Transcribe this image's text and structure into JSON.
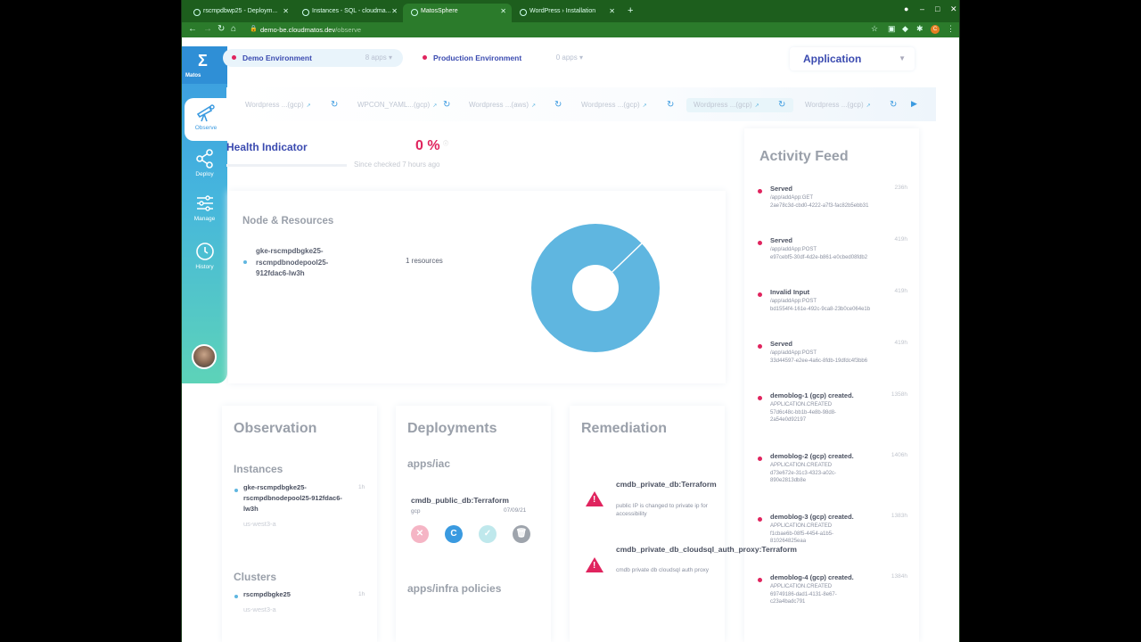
{
  "browser": {
    "tabs": [
      {
        "title": "rscmpdbwp25 - Deploym..."
      },
      {
        "title": "Instances - SQL - cloudma..."
      },
      {
        "title": "MatosSphere"
      },
      {
        "title": "WordPress › Installation"
      }
    ],
    "url_domain": "demo-be.cloudmatos.dev",
    "url_path": "/observe",
    "avatar_letter": "C"
  },
  "app": {
    "logo_text": "Matos",
    "nav": [
      {
        "label": "Observe"
      },
      {
        "label": "Deploy"
      },
      {
        "label": "Manage"
      },
      {
        "label": "History"
      }
    ],
    "environments": [
      {
        "name": "Demo Environment",
        "count": "8 apps"
      },
      {
        "name": "Production Environment",
        "count": "0 apps"
      }
    ],
    "app_select": "Application",
    "app_chips": [
      "Wordpress ...(gcp)",
      "WPCON_YAML...(gcp)",
      "Wordpress ...(aws)",
      "Wordpress ...(gcp)",
      "Wordpress ...(gcp)",
      "Wordpress ...(gcp)"
    ],
    "health": {
      "title": "Health Indicator",
      "percent": "0 %",
      "since": "Since checked 7 hours ago"
    },
    "node": {
      "title": "Node & Resources",
      "name": "gke-rscmpdbgke25-rscmpdbnodepool25-912fdac6-lw3h",
      "resources": "1 resources"
    },
    "activity": {
      "title": "Activity Feed",
      "items": [
        {
          "title": "Served",
          "time": "236h",
          "desc": "/app/addApp:GET\n2ae78c3d-cbd0-4222-a7f3-fac82b5ebb31"
        },
        {
          "title": "Served",
          "time": "419h",
          "desc": "/app/addApp:POST\ne97cebf5-30df-4d2e-b861-e0cbed08fdb2"
        },
        {
          "title": "Invalid Input",
          "time": "419h",
          "desc": "/app/addApp:POST\nbd1554f4-161e-492c-9ca8-23b0ce064e1b"
        },
        {
          "title": "Served",
          "time": "419h",
          "desc": "/app/addApp:POST\n33d44597-e2ee-4a6c-8fdb-19dfdc4f3bb6"
        },
        {
          "title": "demoblog-1 (gcp) created.",
          "time": "1358h",
          "desc": "APPLICATION.CREATED\n57d6c48c-bb1b-4e8b-98d8-\n2a54e0d92197"
        },
        {
          "title": "demoblog-2 (gcp) created.",
          "time": "1406h",
          "desc": "APPLICATION.CREATED\nd73e672e-31c3-4323-a02c-\n890e2813db8e"
        },
        {
          "title": "demoblog-3 (gcp) created.",
          "time": "1383h",
          "desc": "APPLICATION.CREATED\nf1cbae6b-08f5-4454-a1b5-\n810264825eaa"
        },
        {
          "title": "demoblog-4 (gcp) created.",
          "time": "1384h",
          "desc": "APPLICATION.CREATED\n69749186-dad1-4131-8e67-\nc23a4badc791"
        }
      ]
    },
    "observation": {
      "title": "Observation",
      "instances_title": "Instances",
      "instance": {
        "name": "gke-rscmpdbgke25-rscmpdbnodepool25-912fdac6-lw3h",
        "zone": "us-west3-a",
        "time": "1h"
      },
      "clusters_title": "Clusters",
      "cluster": {
        "name": "rscmpdbgke25",
        "zone": "us-west3-a",
        "time": "1h"
      }
    },
    "deployments": {
      "title": "Deployments",
      "iac_title": "apps/iac",
      "item": {
        "name": "cmdb_public_db:Terraform",
        "provider": "gcp",
        "date": "07/09/21"
      },
      "actions": [
        {
          "glyph": "✕",
          "badge": ""
        },
        {
          "glyph": "C",
          "badge": "2"
        },
        {
          "glyph": "✓",
          "badge": ""
        },
        {
          "glyph": "🗑",
          "badge": "0"
        }
      ],
      "policies_title": "apps/infra policies"
    },
    "remediation": {
      "title": "Remediation",
      "items": [
        {
          "name": "cmdb_private_db:Terraform",
          "desc": "public IP is changed to private ip for accessibility"
        },
        {
          "name": "cmdb_private_db_cloudsql_auth_proxy:Terraform",
          "desc": "cmdb private db cloudsql auth proxy"
        }
      ]
    }
  },
  "colors": {
    "accent": "#3b4bb0",
    "alert": "#e0245e",
    "chart": "#5fb6e0"
  }
}
